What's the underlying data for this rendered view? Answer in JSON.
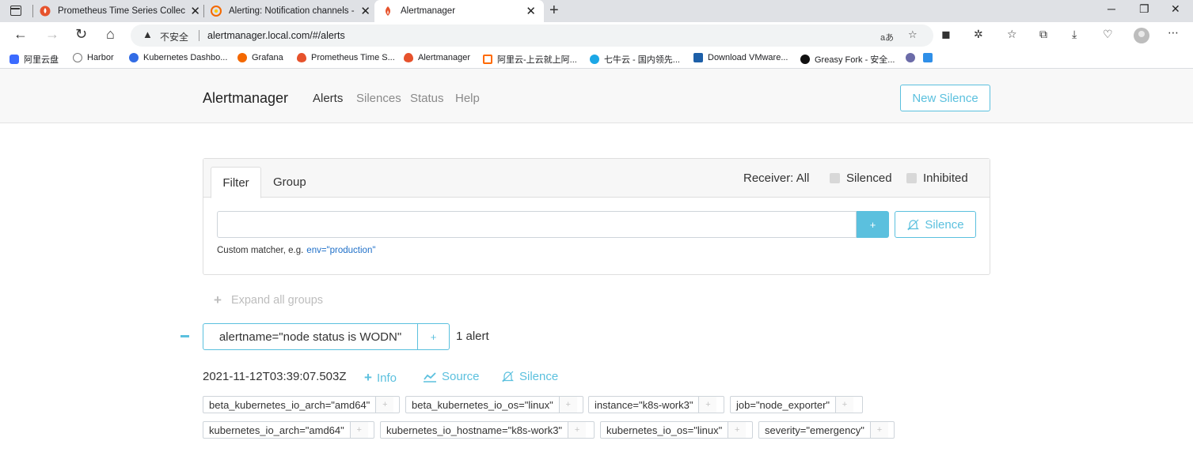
{
  "browser": {
    "tabs": [
      {
        "title": "Prometheus Time Series Collecti",
        "icon": "prometheus-flame-icon"
      },
      {
        "title": "Alerting: Notification channels - ",
        "icon": "grafana-icon"
      },
      {
        "title": "Alertmanager",
        "icon": "prometheus-flame-icon"
      }
    ],
    "close_glyph": "✕",
    "new_tab_glyph": "+",
    "url_insecure": "不安全",
    "url": "alertmanager.local.com/#/alerts",
    "read_aloud": "aあ",
    "bookmarks": [
      {
        "label": "阿里云盘",
        "color": "#3b6bff"
      },
      {
        "label": "Harbor",
        "color": "#7a7a7a"
      },
      {
        "label": "Kubernetes Dashbo...",
        "color": "#326ce5"
      },
      {
        "label": "Grafana",
        "color": "#f46800"
      },
      {
        "label": "Prometheus Time S...",
        "color": "#e6522c"
      },
      {
        "label": "Alertmanager",
        "color": "#e6522c"
      },
      {
        "label": "阿里云-上云就上阿...",
        "color": "#ff6a00"
      },
      {
        "label": "七牛云 - 国内领先...",
        "color": "#1ba7e6"
      },
      {
        "label": "Download VMware...",
        "color": "#1d5fa8"
      },
      {
        "label": "Greasy Fork - 安全...",
        "color": "#111111"
      }
    ]
  },
  "app": {
    "brand": "Alertmanager",
    "nav": [
      "Alerts",
      "Silences",
      "Status",
      "Help"
    ],
    "new_silence": "New Silence",
    "filter_tab": "Filter",
    "group_tab": "Group",
    "receiver": "Receiver: All",
    "silenced": "Silenced",
    "inhibited": "Inhibited",
    "filter_value": "",
    "plus": "+",
    "silence_btn": "Silence",
    "helper_text": "Custom matcher, e.g.",
    "helper_example": "env=\"production\"",
    "expand_all": "Expand all groups",
    "group": {
      "label": "alertname=\"node status is WODN\"",
      "count": "1 alert"
    },
    "alert": {
      "timestamp": "2021-11-12T03:39:07.503Z",
      "info": "Info",
      "source": "Source",
      "silence": "Silence",
      "labels": [
        "beta_kubernetes_io_arch=\"amd64\"",
        "beta_kubernetes_io_os=\"linux\"",
        "instance=\"k8s-work3\"",
        "job=\"node_exporter\"",
        "kubernetes_io_arch=\"amd64\"",
        "kubernetes_io_hostname=\"k8s-work3\"",
        "kubernetes_io_os=\"linux\"",
        "severity=\"emergency\""
      ]
    }
  },
  "colors": {
    "accent": "#5bc0de",
    "link": "#1e6fc8"
  }
}
